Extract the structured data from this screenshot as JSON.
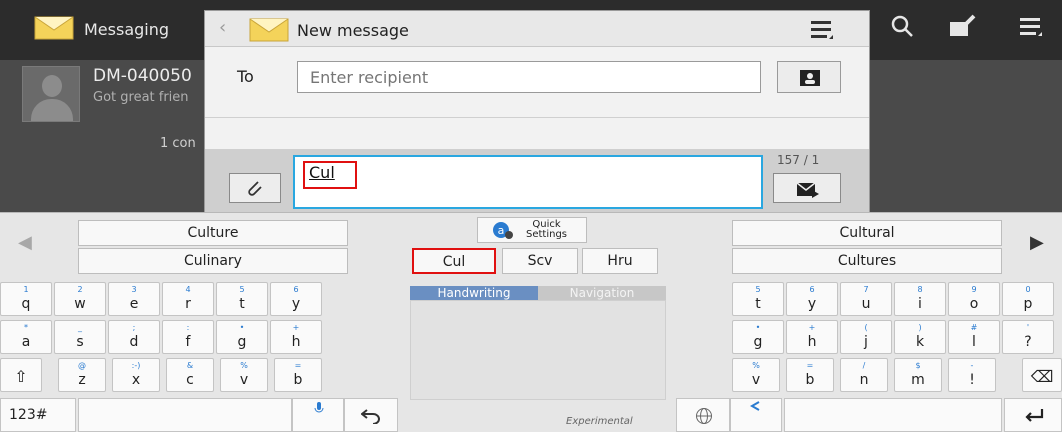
{
  "background_app": {
    "title": "Messaging",
    "conversation": {
      "name": "DM-040050",
      "preview": "Got great frien",
      "count_text": "1 con"
    },
    "icons": [
      "search-icon",
      "compose-icon",
      "menu-icon"
    ]
  },
  "dialog": {
    "title": "New message",
    "to_label": "To",
    "recipient_placeholder": "Enter recipient",
    "message_text": "Cul",
    "counter": "157 / 1"
  },
  "keyboard": {
    "suggestions_left": [
      "Culture",
      "Culinary"
    ],
    "suggestions_right": [
      "Cultural",
      "Cultures"
    ],
    "candidates": [
      "Cul",
      "Scv",
      "Hru"
    ],
    "quick_settings": "Quick\nSettings",
    "hw_tabs": [
      "Handwriting",
      "Navigation"
    ],
    "hw_note": "Experimental",
    "row1_left": [
      {
        "h": "1",
        "k": "q"
      },
      {
        "h": "2",
        "k": "w"
      },
      {
        "h": "3",
        "k": "e"
      },
      {
        "h": "4",
        "k": "r"
      },
      {
        "h": "5",
        "k": "t"
      },
      {
        "h": "6",
        "k": "y"
      }
    ],
    "row1_right": [
      {
        "h": "5",
        "k": "t"
      },
      {
        "h": "6",
        "k": "y"
      },
      {
        "h": "7",
        "k": "u"
      },
      {
        "h": "8",
        "k": "i"
      },
      {
        "h": "9",
        "k": "o"
      },
      {
        "h": "0",
        "k": "p"
      }
    ],
    "row2_left": [
      {
        "h": "*",
        "k": "a"
      },
      {
        "h": "_",
        "k": "s"
      },
      {
        "h": ";",
        "k": "d"
      },
      {
        "h": ":",
        "k": "f"
      },
      {
        "h": "•",
        "k": "g"
      },
      {
        "h": "+",
        "k": "h"
      }
    ],
    "row2_right": [
      {
        "h": "•",
        "k": "g"
      },
      {
        "h": "+",
        "k": "h"
      },
      {
        "h": "(",
        "k": "j"
      },
      {
        "h": ")",
        "k": "k"
      },
      {
        "h": "#",
        "k": "l"
      },
      {
        "h": "'",
        "k": "?"
      }
    ],
    "row3_left": [
      {
        "h": "@",
        "k": "z"
      },
      {
        "h": ":-)",
        "k": "x"
      },
      {
        "h": "&",
        "k": "c"
      },
      {
        "h": "%",
        "k": "v"
      },
      {
        "h": "=",
        "k": "b"
      }
    ],
    "row3_right": [
      {
        "h": "%",
        "k": "v"
      },
      {
        "h": "=",
        "k": "b"
      },
      {
        "h": "/",
        "k": "n"
      },
      {
        "h": "$",
        "k": "m"
      },
      {
        "h": "-",
        "k": "!"
      }
    ],
    "symbols_key": "123#"
  }
}
